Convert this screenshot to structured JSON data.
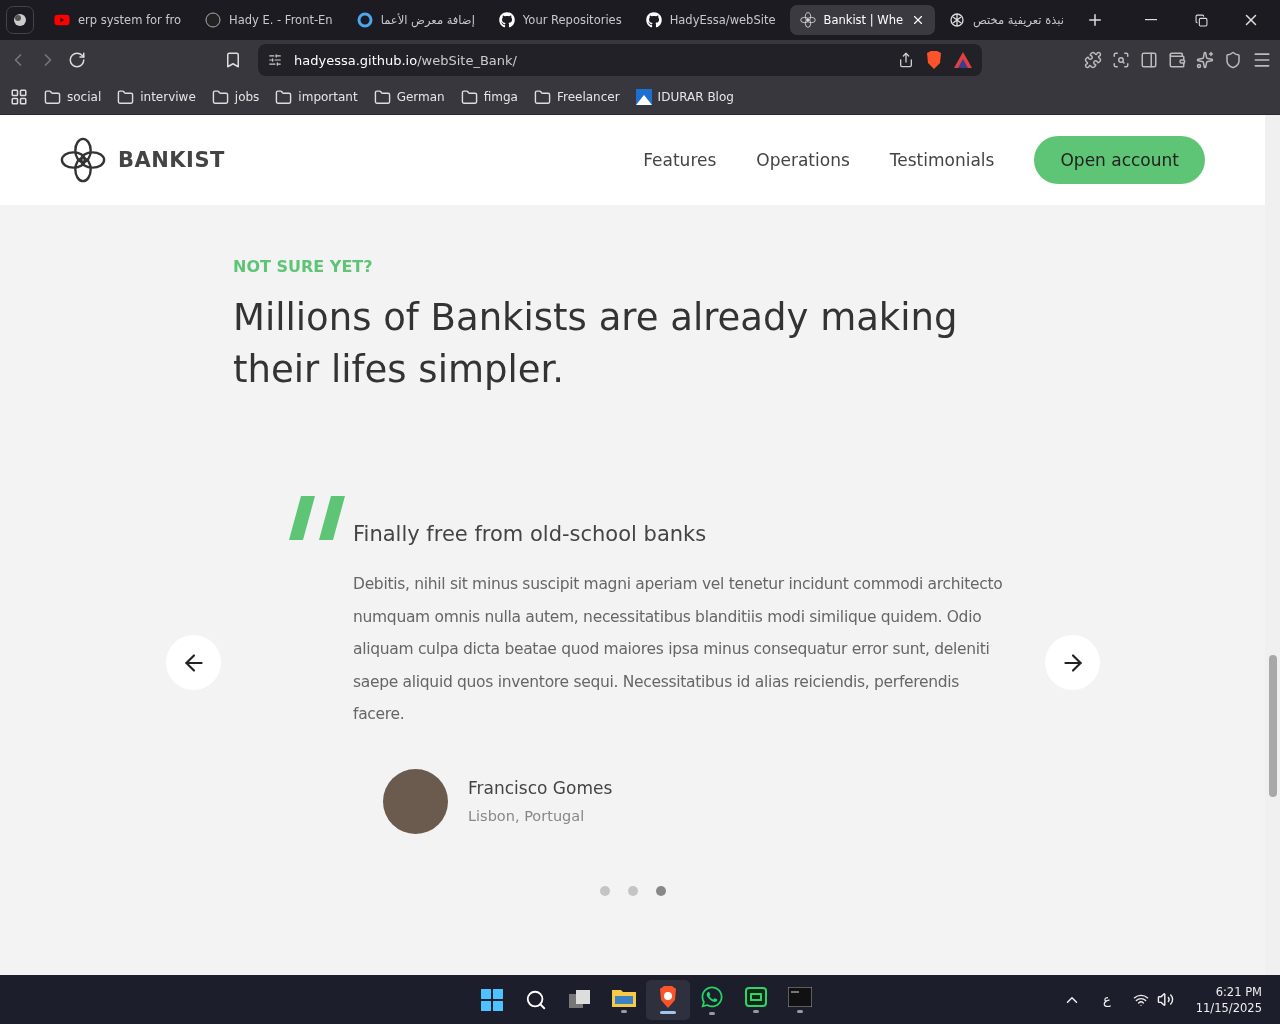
{
  "browser": {
    "tabs": [
      {
        "title": "erp system for fro",
        "selected": false
      },
      {
        "title": "Hady E. - Front-En",
        "selected": false
      },
      {
        "title": "إضافة معرض الأعما",
        "selected": false
      },
      {
        "title": "Your Repositories",
        "selected": false
      },
      {
        "title": "HadyEssa/webSite",
        "selected": false
      },
      {
        "title": "Bankist | Whe",
        "selected": true
      },
      {
        "title": "نبذة تعريفية مختص",
        "selected": false
      }
    ],
    "url_host": "hadyessa.github.io",
    "url_path": "/webSite_Bank/",
    "bookmarks": [
      {
        "kind": "folder",
        "label": "social"
      },
      {
        "kind": "folder",
        "label": "interviwe"
      },
      {
        "kind": "folder",
        "label": "jobs"
      },
      {
        "kind": "folder",
        "label": "important"
      },
      {
        "kind": "folder",
        "label": "German"
      },
      {
        "kind": "folder",
        "label": "fimga"
      },
      {
        "kind": "folder",
        "label": "Freelancer"
      },
      {
        "kind": "site",
        "label": "IDURAR Blog"
      }
    ]
  },
  "site": {
    "logo": "BANKIST",
    "nav": [
      "Features",
      "Operations",
      "Testimonials"
    ],
    "cta": "Open account",
    "section": {
      "eyebrow": "NOT SURE YET?",
      "heading": "Millions of Bankists are already making their lifes simpler.",
      "testimonial": {
        "title": "Finally free from old-school banks",
        "text": "Debitis, nihil sit minus suscipit magni aperiam vel tenetur incidunt commodi architecto numquam omnis nulla autem, necessitatibus blanditiis modi similique quidem. Odio aliquam culpa dicta beatae quod maiores ipsa minus consequatur error sunt, deleniti saepe aliquid quos inventore sequi. Necessitatibus id alias reiciendis, perferendis facere.",
        "name": "Francisco Gomes",
        "location": "Lisbon, Portugal"
      },
      "dots": [
        {
          "selected": false
        },
        {
          "selected": false
        },
        {
          "selected": true
        }
      ]
    }
  },
  "taskbar": {
    "apps": [
      {
        "kind": "start",
        "running": false,
        "selected": false
      },
      {
        "kind": "search",
        "running": false,
        "selected": false
      },
      {
        "kind": "taskview",
        "running": false,
        "selected": false
      },
      {
        "kind": "folder",
        "running": true,
        "selected": false
      },
      {
        "kind": "lion",
        "running": true,
        "selected": true
      },
      {
        "kind": "chat",
        "running": true,
        "selected": false
      },
      {
        "kind": "monitor",
        "running": true,
        "selected": false
      },
      {
        "kind": "terminal",
        "running": true,
        "selected": false
      }
    ],
    "language": "ع",
    "time": "6:21 PM",
    "date": "11/15/2025"
  }
}
